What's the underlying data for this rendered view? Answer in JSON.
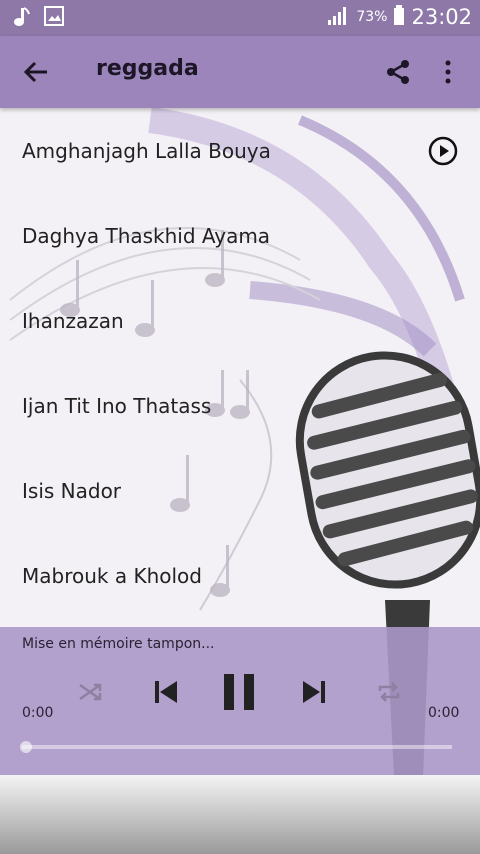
{
  "status_bar": {
    "battery_percent": "73%",
    "time": "23:02",
    "left_icons": [
      "music-note-icon",
      "image-icon"
    ]
  },
  "toolbar": {
    "title": "reggada",
    "back_icon": "arrow-back-icon",
    "share_icon": "share-icon",
    "menu_icon": "more-vert-icon"
  },
  "tracks": [
    {
      "title": "Amghanjagh Lalla Bouya",
      "playing": true
    },
    {
      "title": "Daghya Thaskhid Ayama"
    },
    {
      "title": "Ihanzazan"
    },
    {
      "title": "Ijan Tit Ino Thatass"
    },
    {
      "title": "Isis Nador"
    },
    {
      "title": "Mabrouk a Kholod"
    }
  ],
  "player": {
    "status": "Mise en mémoire tampon...",
    "current_time": "0:00",
    "total_time": "0:00",
    "progress": 0
  },
  "colors": {
    "toolbar": "#9b85bb",
    "status_bar": "#8d78a8",
    "player": "#ab98c8"
  }
}
